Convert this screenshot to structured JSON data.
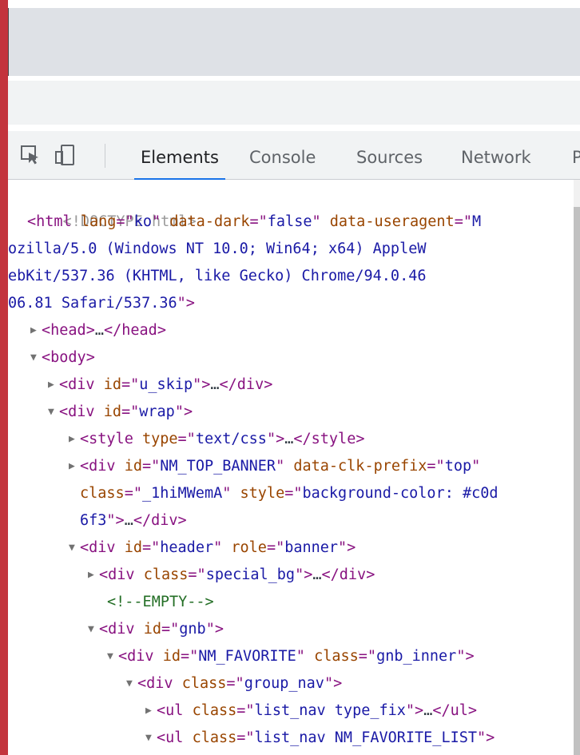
{
  "toolbar": {
    "tabs": [
      "Elements",
      "Console",
      "Sources",
      "Network",
      "P"
    ],
    "active_tab": "Elements",
    "icons": [
      "inspect-element-icon",
      "device-toolbar-icon"
    ]
  },
  "dom": {
    "doctype": "<!DOCTYPE html>",
    "html_open": {
      "tag": "html",
      "attrs": [
        {
          "name": "lang",
          "value": "ko"
        },
        {
          "name": "data-dark",
          "value": "false"
        },
        {
          "name": "data-useragent",
          "value": "Mozilla/5.0 (Windows NT 10.0; Win64; x64) AppleWebKit/537.36 (KHTML, like Gecko) Chrome/94.0.4606.81 Safari/537.36"
        }
      ]
    },
    "head": "head",
    "body": "body",
    "u_skip": {
      "tag": "div",
      "attr": "id",
      "value": "u_skip"
    },
    "wrap": {
      "tag": "div",
      "attr": "id",
      "value": "wrap"
    },
    "style": {
      "tag": "style",
      "attr": "type",
      "value": "text/css"
    },
    "top_banner": {
      "tag": "div",
      "id": "NM_TOP_BANNER",
      "clk_attr": "data-clk-prefix",
      "clk": "top",
      "class": "_1hiMWemA",
      "style": "background-color: #c0d6f3"
    },
    "header": {
      "tag": "div",
      "id": "header",
      "role": "banner"
    },
    "special_bg": {
      "tag": "div",
      "class": "special_bg"
    },
    "comment": "<!--EMPTY-->",
    "gnb": {
      "tag": "div",
      "id": "gnb"
    },
    "favorite": {
      "tag": "div",
      "id": "NM_FAVORITE",
      "class": "gnb_inner"
    },
    "group_nav": {
      "tag": "div",
      "class": "group_nav"
    },
    "list_nav_fix": {
      "tag": "ul",
      "class": "list_nav type_fix"
    },
    "list_nav_fav": {
      "tag": "ul",
      "class": "list_nav NM_FAVORITE_LIST"
    }
  },
  "colors": {
    "accent_bar": "#c3343d",
    "tab_underline": "#1a73e8",
    "tag": "#881280",
    "attr_name": "#994500",
    "attr_value": "#1a1aa6"
  }
}
